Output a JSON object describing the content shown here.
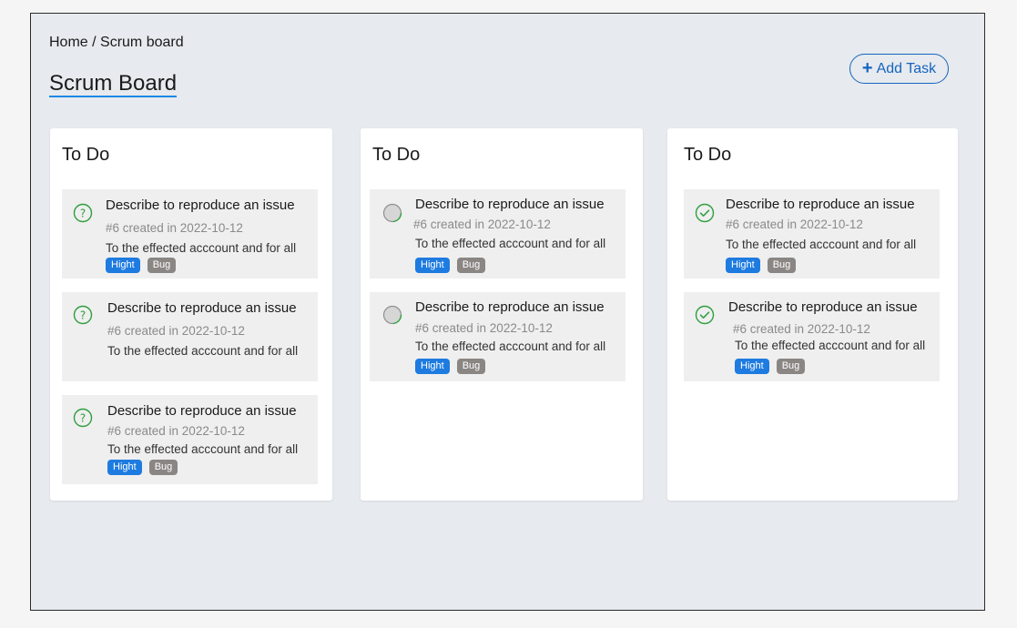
{
  "breadcrumb": "Home / Scrum board",
  "page_title": "Scrum Board",
  "add_task": {
    "icon": "+",
    "label": "Add Task"
  },
  "colors": {
    "accent": "#1e88e5",
    "priority_tag": "#1e7be0",
    "type_tag": "#8a8684",
    "done_green": "#2e9e3e"
  },
  "columns": [
    {
      "title": "To Do",
      "status_icon": "question-circle-icon",
      "cards": [
        {
          "title": "Describe to reproduce an issue",
          "meta": "#6 created in 2022-10-12",
          "desc": "To the effected acccount and for all",
          "tags": [
            "Hight",
            "Bug"
          ]
        },
        {
          "title": "Describe to reproduce an issue",
          "meta": "#6 created in 2022-10-12",
          "desc": "To the effected acccount and for all",
          "tags": []
        },
        {
          "title": "Describe to reproduce an issue",
          "meta": "#6 created in 2022-10-12",
          "desc": "To the effected acccount and for all",
          "tags": [
            "Hight",
            "Bug"
          ]
        }
      ]
    },
    {
      "title": "To Do",
      "status_icon": "in-progress-circle-icon",
      "cards": [
        {
          "title": "Describe to reproduce an issue",
          "meta": "#6 created in 2022-10-12",
          "desc": "To the effected acccount and for all",
          "tags": [
            "Hight",
            "Bug"
          ]
        },
        {
          "title": "Describe to reproduce an issue",
          "meta": "#6 created in 2022-10-12",
          "desc": "To the effected acccount and for all",
          "tags": [
            "Hight",
            "Bug"
          ]
        }
      ]
    },
    {
      "title": "To Do",
      "status_icon": "check-circle-icon",
      "cards": [
        {
          "title": "Describe to reproduce an issue",
          "meta": "#6 created in 2022-10-12",
          "desc": "To the effected acccount and for all",
          "tags": [
            "Hight",
            "Bug"
          ]
        },
        {
          "title": "Describe to reproduce an issue",
          "meta": "#6 created in 2022-10-12",
          "desc": "To the effected acccount and for all",
          "tags": [
            "Hight",
            "Bug"
          ]
        }
      ]
    }
  ]
}
